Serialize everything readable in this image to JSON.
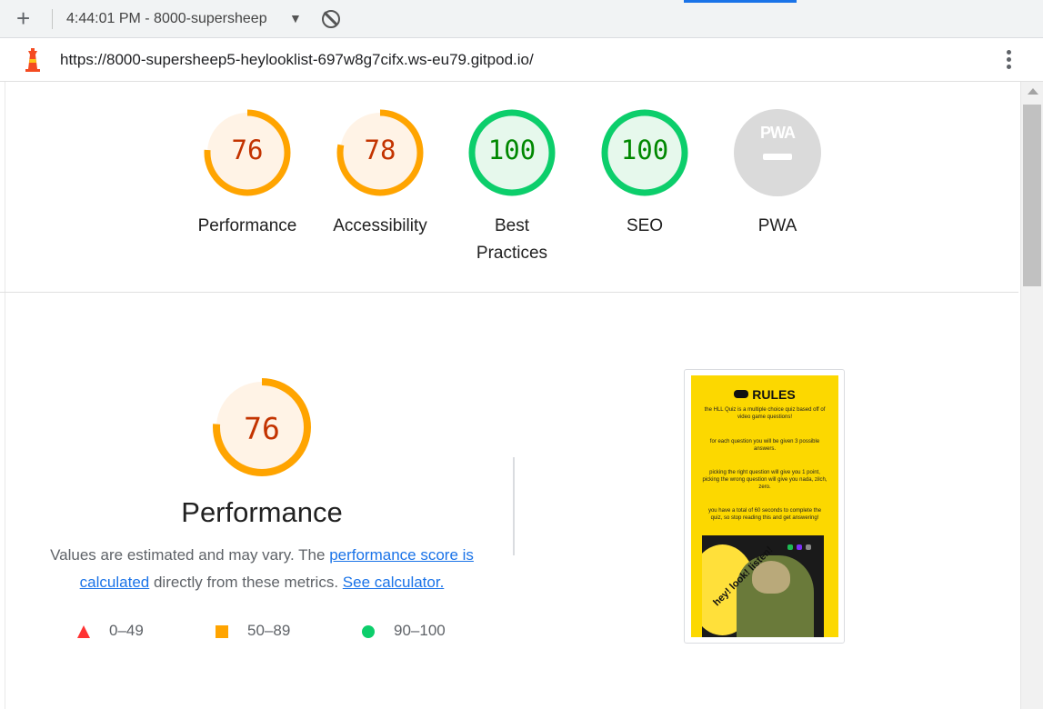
{
  "devtools": {
    "new_report_label": "+",
    "session_label": "4:44:01 PM - 8000-supersheep",
    "session_caret": "▼",
    "url": "https://8000-supersheep5-heylooklist-697w8g7cifx.ws-eu79.gitpod.io/"
  },
  "colors": {
    "fail": "#ff3333",
    "average": "#ffa400",
    "pass": "#0cce6b",
    "average_text": "#c33300",
    "pass_text": "#008800",
    "average_bg": "#fff3e6",
    "pass_bg": "#e6f8ec"
  },
  "gauges": [
    {
      "score": 76,
      "label": "Performance",
      "rating": "average"
    },
    {
      "score": 78,
      "label": "Accessibility",
      "rating": "average"
    },
    {
      "score": 100,
      "label": "Best Practices",
      "rating": "pass"
    },
    {
      "score": 100,
      "label": "SEO",
      "rating": "pass"
    },
    {
      "score": null,
      "label": "PWA",
      "rating": "pwa",
      "badge": "PWA"
    }
  ],
  "performance": {
    "score": 76,
    "title": "Performance",
    "desc_prefix": "Values are estimated and may vary. The ",
    "desc_link1": "performance score is calculated",
    "desc_mid": " directly from these metrics. ",
    "desc_link2": "See calculator.",
    "legend": [
      {
        "range": "0–49",
        "shape": "triangle"
      },
      {
        "range": "50–89",
        "shape": "square"
      },
      {
        "range": "90–100",
        "shape": "circle"
      }
    ]
  },
  "screenshot": {
    "heading": "RULES",
    "paragraphs": [
      "the HLL Quiz is a multiple choice quiz based off of video game questions!",
      "for each question you will be given 3 possible answers.",
      "picking the right question will give you 1 point, picking the wrong question will give you nada, zilch, zero.",
      "you have a total of 60 seconds to complete the quiz, so stop reading this and get answering!"
    ],
    "art_text": "hey! look! listen!"
  }
}
